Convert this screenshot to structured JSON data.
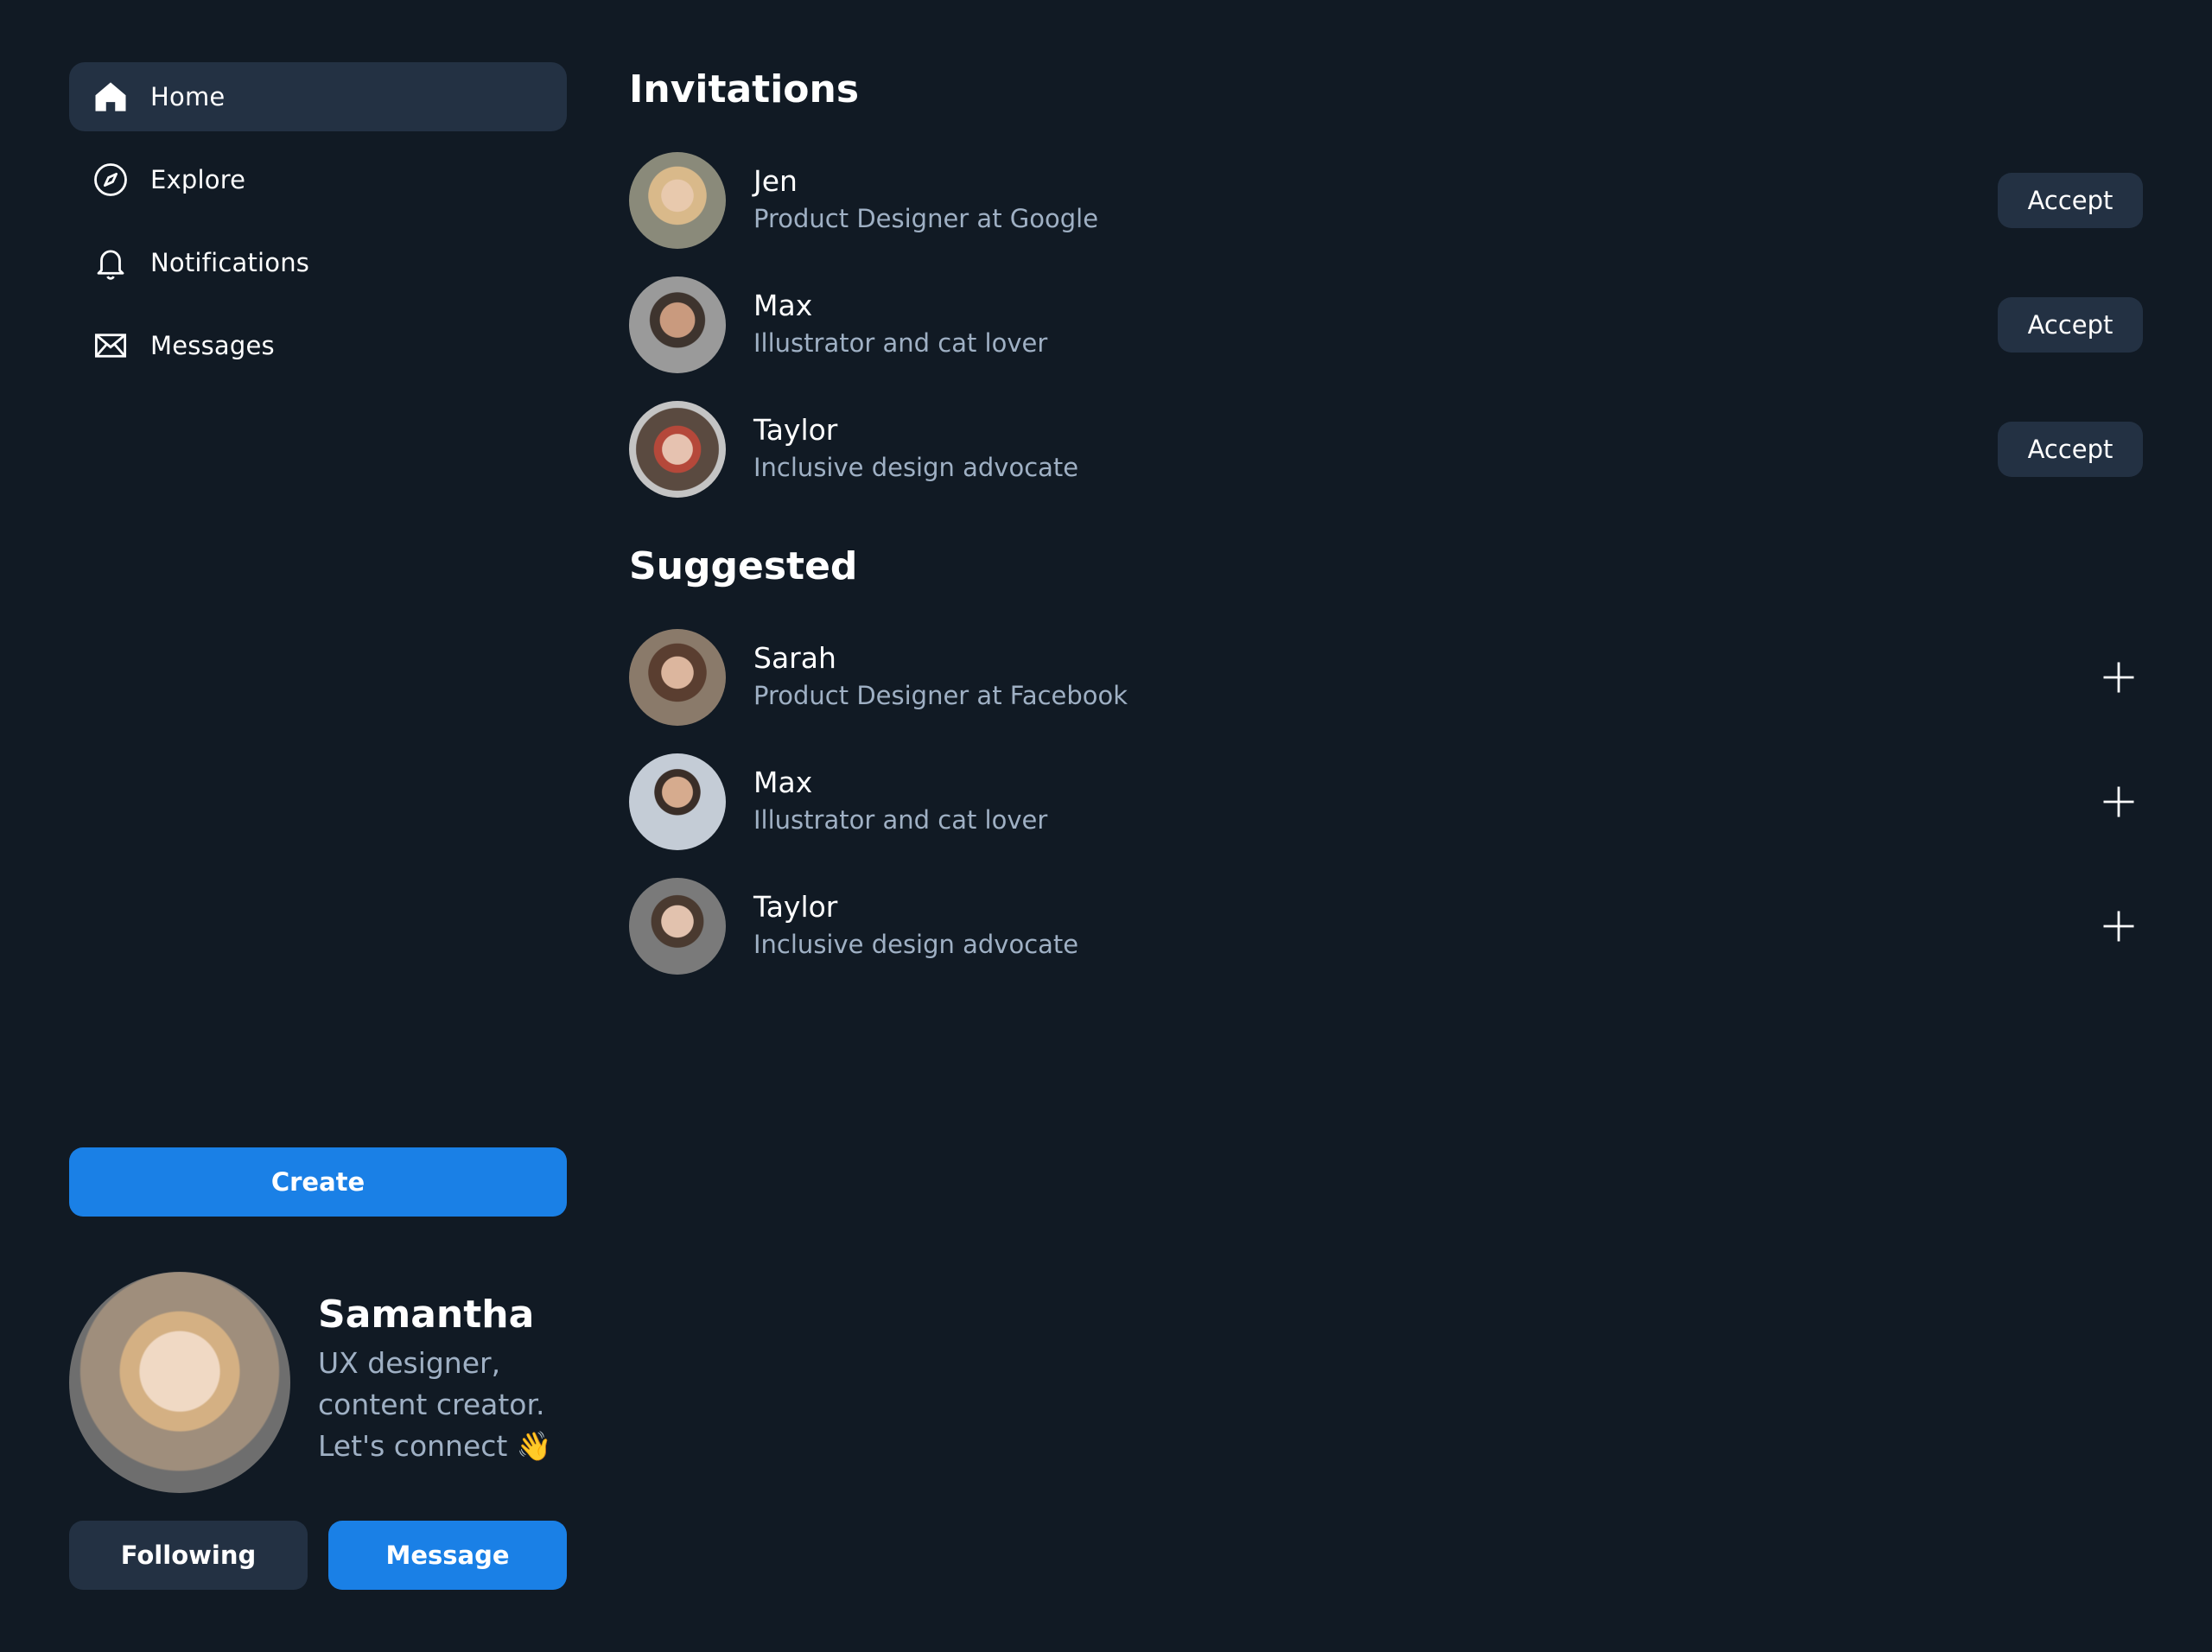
{
  "sidebar": {
    "items": [
      {
        "label": "Home",
        "icon": "home-icon",
        "active": true
      },
      {
        "label": "Explore",
        "icon": "compass-icon",
        "active": false
      },
      {
        "label": "Notifications",
        "icon": "bell-icon",
        "active": false
      },
      {
        "label": "Messages",
        "icon": "mail-icon",
        "active": false
      }
    ],
    "create_label": "Create"
  },
  "profile": {
    "name": "Samantha",
    "bio": "UX designer, content creator. Let's connect 👋",
    "following_label": "Following",
    "message_label": "Message"
  },
  "invitations": {
    "title": "Invitations",
    "accept_label": "Accept",
    "people": [
      {
        "name": "Jen",
        "desc": "Product Designer at Google"
      },
      {
        "name": "Max",
        "desc": "Illustrator and cat lover"
      },
      {
        "name": "Taylor",
        "desc": "Inclusive design advocate"
      }
    ]
  },
  "suggested": {
    "title": "Suggested",
    "people": [
      {
        "name": "Sarah",
        "desc": "Product Designer at Facebook"
      },
      {
        "name": "Max",
        "desc": "Illustrator and cat lover"
      },
      {
        "name": "Taylor",
        "desc": "Inclusive design advocate"
      }
    ]
  },
  "colors": {
    "background": "#111a24",
    "surface": "#233143",
    "accent": "#1a80e6",
    "muted_text": "#9fb0c4"
  }
}
